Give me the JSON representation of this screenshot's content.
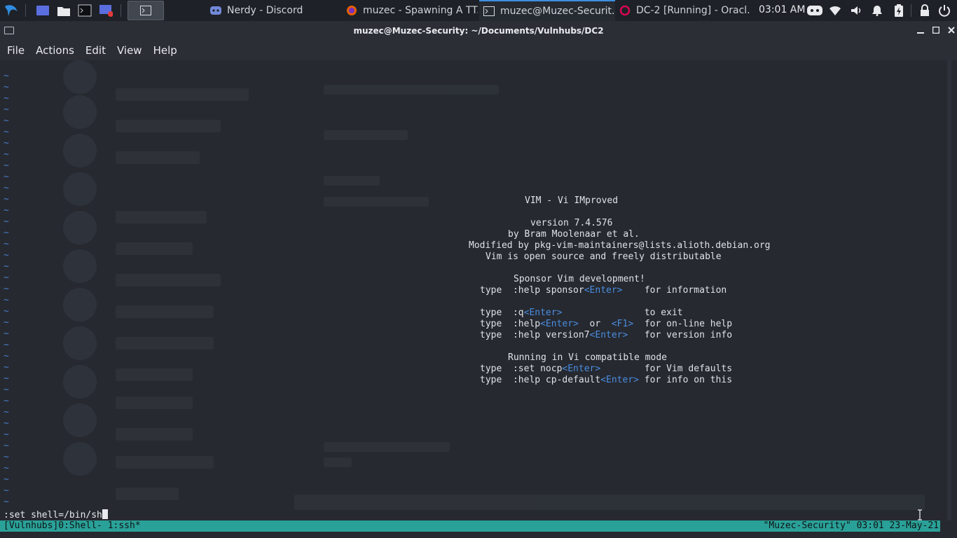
{
  "taskbar": {
    "tasks": [
      {
        "label": "Nerdy - Discord",
        "icon": "discord-icon"
      },
      {
        "label": "muzec - Spawning A TT...",
        "icon": "firefox-icon"
      },
      {
        "label": "muzec@Muzec-Securit...",
        "icon": "terminal-icon",
        "active": true
      },
      {
        "label": "DC-2 [Running] - Oracl...",
        "icon": "debian-icon"
      }
    ],
    "clock": "03:01 AM",
    "tray_icons": [
      "discord-icon",
      "wifi-icon",
      "volume-icon",
      "notification-bell-icon",
      "battery-icon",
      "lock-icon",
      "power-icon"
    ]
  },
  "window": {
    "title": "muzec@Muzec-Security: ~/Documents/Vulnhubs/DC2",
    "controls": [
      "minimize-icon",
      "maximize-icon",
      "close-icon"
    ]
  },
  "menu": {
    "items": [
      "File",
      "Actions",
      "Edit",
      "View",
      "Help"
    ]
  },
  "vim": {
    "tilde": "~",
    "splash": [
      {
        "pad": 37,
        "text": "VIM - Vi IMproved"
      },
      {
        "pad": 0,
        "text": ""
      },
      {
        "pad": 38,
        "text": "version 7.4.576"
      },
      {
        "pad": 34,
        "text": "by Bram Moolenaar et al."
      },
      {
        "pad": 27,
        "text": "Modified by pkg-vim-maintainers@lists.alioth.debian.org"
      },
      {
        "pad": 30,
        "text": "Vim is open source and freely distributable"
      },
      {
        "pad": 0,
        "text": ""
      },
      {
        "pad": 35,
        "text": "Sponsor Vim development!"
      },
      {
        "pad": 29,
        "parts": [
          [
            "type  :help sponsor",
            ""
          ],
          [
            "<Enter>",
            "kbd"
          ],
          [
            "    for information",
            ""
          ]
        ]
      },
      {
        "pad": 0,
        "text": ""
      },
      {
        "pad": 29,
        "parts": [
          [
            "type  :q",
            ""
          ],
          [
            "<Enter>",
            "kbd"
          ],
          [
            "               to exit",
            ""
          ]
        ]
      },
      {
        "pad": 29,
        "parts": [
          [
            "type  :help",
            ""
          ],
          [
            "<Enter>",
            "kbd"
          ],
          [
            "  or  ",
            ""
          ],
          [
            "<F1>",
            "kbd"
          ],
          [
            "  for on-line help",
            ""
          ]
        ]
      },
      {
        "pad": 29,
        "parts": [
          [
            "type  :help version7",
            ""
          ],
          [
            "<Enter>",
            "kbd"
          ],
          [
            "   for version info",
            ""
          ]
        ]
      },
      {
        "pad": 0,
        "text": ""
      },
      {
        "pad": 34,
        "text": "Running in Vi compatible mode"
      },
      {
        "pad": 29,
        "parts": [
          [
            "type  :set nocp",
            ""
          ],
          [
            "<Enter>",
            "kbd"
          ],
          [
            "        for Vim defaults",
            ""
          ]
        ]
      },
      {
        "pad": 29,
        "parts": [
          [
            "type  :help cp-default",
            ""
          ],
          [
            "<Enter>",
            "kbd"
          ],
          [
            " for info on this",
            ""
          ]
        ]
      }
    ],
    "command": ":set shell=/bin/sh"
  },
  "tmux": {
    "left": "[Vulnhubs]0:Shell- 1:ssh*",
    "right": "\"Muzec-Security\" 03:01 23-May-21"
  }
}
